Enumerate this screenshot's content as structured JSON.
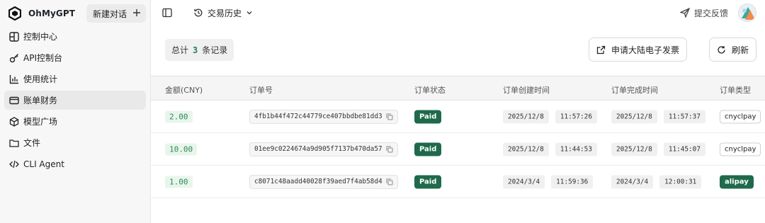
{
  "sidebar": {
    "brand": "OhMyGPT",
    "new_chat": "新建对话",
    "items": [
      {
        "label": "控制中心",
        "icon": "dashboard-icon"
      },
      {
        "label": "API控制台",
        "icon": "key-icon"
      },
      {
        "label": "使用统计",
        "icon": "bar-chart-icon"
      },
      {
        "label": "账单财务",
        "icon": "credit-card-icon",
        "active": true
      },
      {
        "label": "模型广场",
        "icon": "cube-icon"
      },
      {
        "label": "文件",
        "icon": "folder-icon"
      },
      {
        "label": "CLI Agent",
        "icon": "code-icon"
      }
    ]
  },
  "topbar": {
    "history": "交易历史",
    "feedback": "提交反馈"
  },
  "toolbar": {
    "total_prefix": "总计",
    "total_count": "3",
    "total_suffix": "条记录",
    "invoice": "申请大陆电子发票",
    "refresh": "刷新"
  },
  "table": {
    "headers": [
      "金额(CNY)",
      "订单号",
      "订单状态",
      "订单创建时间",
      "订单完成时间",
      "订单类型"
    ],
    "rows": [
      {
        "amount": "2.00",
        "order": "4fb1b44f472c44779ce407bbdbe81dd3",
        "status": "Paid",
        "created_date": "2025/12/8",
        "created_time": "11:57:26",
        "finished_date": "2025/12/8",
        "finished_time": "11:57:37",
        "type": "cnyclpay"
      },
      {
        "amount": "10.00",
        "order": "01ee9c0224674a9d905f7137b470da57",
        "status": "Paid",
        "created_date": "2025/12/8",
        "created_time": "11:44:53",
        "finished_date": "2025/12/8",
        "finished_time": "11:45:07",
        "type": "cnyclpay"
      },
      {
        "amount": "1.00",
        "order": "c8071c48aadd40028f39aed7f4ab58d4",
        "status": "Paid",
        "created_date": "2024/3/4",
        "created_time": "11:59:36",
        "finished_date": "2024/3/4",
        "finished_time": "12:00:31",
        "type": "alipay"
      }
    ]
  },
  "colors": {
    "accent_green": "#1e6a4a",
    "amount_green": "#2e8b57"
  }
}
